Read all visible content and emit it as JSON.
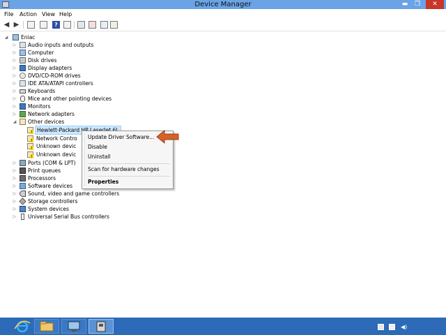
{
  "window": {
    "title": "Device Manager",
    "buttons": {
      "minimize": "▬",
      "maximize": "❐",
      "close": "✕"
    }
  },
  "menubar": [
    "File",
    "Action",
    "View",
    "Help"
  ],
  "toolbar_icons": [
    "back-icon",
    "forward-icon",
    "show-hide-tree-icon",
    "properties-icon",
    "help-icon",
    "view-icon",
    "update-driver-icon",
    "uninstall-icon",
    "scan-hardware-icon"
  ],
  "tree": {
    "root": "Eniac",
    "categories": [
      {
        "label": "Audio inputs and outputs",
        "icon": "speaker-icon"
      },
      {
        "label": "Computer",
        "icon": "computer-icon"
      },
      {
        "label": "Disk drives",
        "icon": "disk-icon"
      },
      {
        "label": "Display adapters",
        "icon": "display-icon"
      },
      {
        "label": "DVD/CD-ROM drives",
        "icon": "dvd-icon"
      },
      {
        "label": "IDE ATA/ATAPI controllers",
        "icon": "ide-icon"
      },
      {
        "label": "Keyboards",
        "icon": "keyboard-icon"
      },
      {
        "label": "Mice and other pointing devices",
        "icon": "mouse-icon"
      },
      {
        "label": "Monitors",
        "icon": "monitor-icon"
      },
      {
        "label": "Network adapters",
        "icon": "network-icon"
      },
      {
        "label": "Other devices",
        "icon": "other-devices-icon"
      }
    ],
    "other_devices_children": [
      "Hewlett-Packard HP LaserJet 6L",
      "Network Contro",
      "Unknown devic",
      "Unknown devic"
    ],
    "categories_after": [
      {
        "label": "Ports (COM & LPT)",
        "icon": "port-icon"
      },
      {
        "label": "Print queues",
        "icon": "printer-icon"
      },
      {
        "label": "Processors",
        "icon": "processor-icon"
      },
      {
        "label": "Software devices",
        "icon": "software-icon"
      },
      {
        "label": "Sound, video and game controllers",
        "icon": "sound-icon"
      },
      {
        "label": "Storage controllers",
        "icon": "storage-icon"
      },
      {
        "label": "System devices",
        "icon": "system-icon"
      },
      {
        "label": "Universal Serial Bus controllers",
        "icon": "usb-icon"
      }
    ]
  },
  "context_menu": {
    "items": [
      "Update Driver Software...",
      "Disable",
      "Uninstall",
      "Scan for hardware changes",
      "Properties"
    ]
  },
  "colors": {
    "titlebar": "#6aa3e6",
    "taskbar": "#2d6ab7",
    "close_button": "#c7352b",
    "annotation_arrow": "#d4622a",
    "selection": "#cde8ff"
  }
}
